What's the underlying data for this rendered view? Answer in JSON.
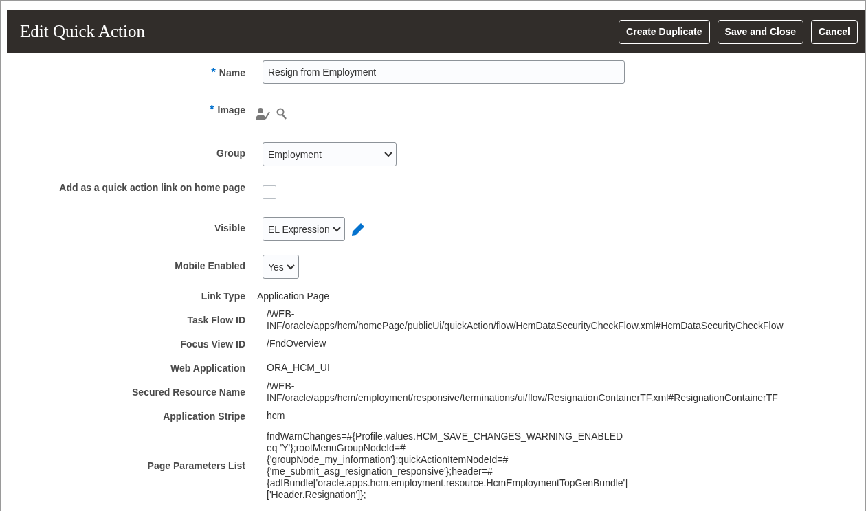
{
  "header": {
    "title": "Edit Quick Action",
    "buttons": [
      {
        "label": "Create Duplicate",
        "mnemonic": false
      },
      {
        "label": "Save and Close",
        "mnemonic": true
      },
      {
        "label": "Cancel",
        "mnemonic": true
      }
    ]
  },
  "fields": [
    {
      "kind": "text",
      "label": "Name",
      "marker": "*",
      "value": "Resign from Employment"
    },
    {
      "kind": "image",
      "label": "Image",
      "marker": "*"
    },
    {
      "kind": "list",
      "label": "Group",
      "value": "Employment"
    },
    {
      "kind": "checkbox",
      "label": "Add as a quick action link on home page",
      "checked": false
    },
    {
      "kind": "select",
      "label": "Visible",
      "value": "EL Expression",
      "editable": true
    },
    {
      "kind": "select",
      "label": "Mobile Enabled",
      "value": "Yes",
      "editable": false
    },
    {
      "kind": "output",
      "label": "Link Type",
      "value": "Application Page"
    },
    {
      "kind": "readonly",
      "label": "Task Flow ID",
      "value": "/WEB-INF/oracle/apps/hcm/homePage/publicUi/quickAction/flow/HcmDataSecurityCheckFlow.xml#HcmDataSecurityCheckFlow"
    },
    {
      "kind": "readonly",
      "label": "Focus View ID",
      "value": "/FndOverview"
    },
    {
      "kind": "readonly",
      "label": "Web Application",
      "value": "ORA_HCM_UI"
    },
    {
      "kind": "readonly",
      "label": "Secured Resource Name",
      "value": "/WEB-INF/oracle/apps/hcm/employment/responsive/terminations/ui/flow/ResignationContainerTF.xml#ResignationContainerTF"
    },
    {
      "kind": "readonly",
      "label": "Application Stripe",
      "value": "hcm"
    },
    {
      "kind": "long",
      "label": "Page Parameters List",
      "value": "fndWarnChanges=#{Profile.values.HCM_SAVE_CHANGES_WARNING_ENABLED eq 'Y'};rootMenuGroupNodeId=#{'groupNode_my_information'};quickActionItemNodeId=#{'me_submit_asg_resignation_responsive'};header=#{adfBundle['oracle.apps.hcm.employment.resource.HcmEmploymentTopGenBundle']['Header.Resignation']};"
    }
  ]
}
